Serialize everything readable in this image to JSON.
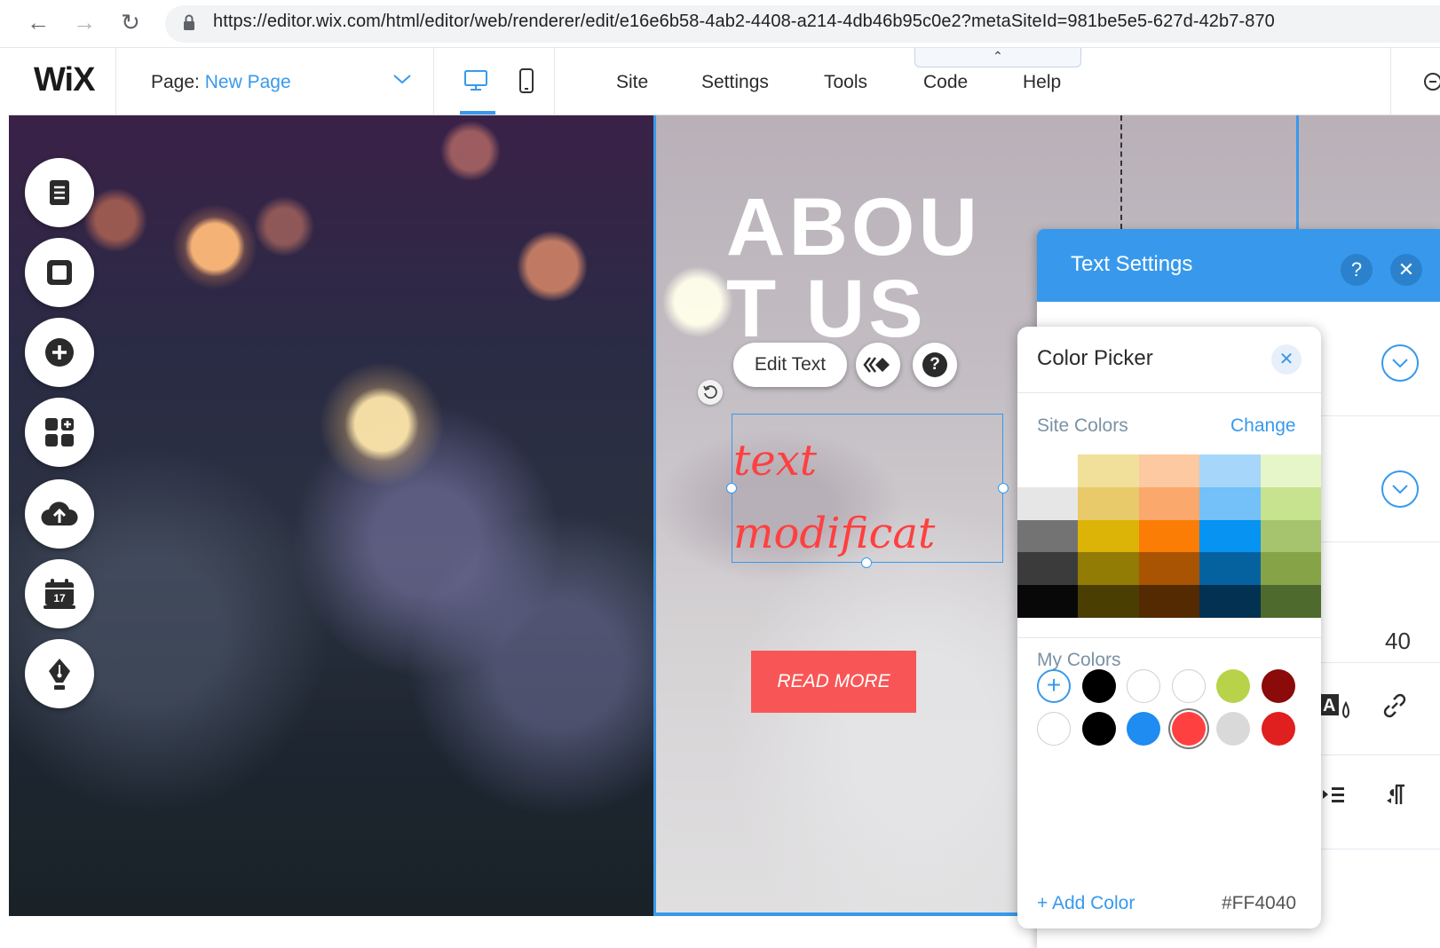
{
  "browser": {
    "url": "https://editor.wix.com/html/editor/web/renderer/edit/e16e6b58-4ab2-4408-a214-4db46b95c0e2?metaSiteId=981be5e5-627d-42b7-870"
  },
  "wix_bar": {
    "logo": "WiX",
    "page_prefix": "Page:",
    "page_name": "New Page",
    "menu": [
      "Site",
      "Settings",
      "Tools",
      "Code",
      "Help"
    ],
    "code_tab_glyph": "⌃"
  },
  "canvas": {
    "about_title_line1": "ABOU",
    "about_title_line2": "T US",
    "edit_text_label": "Edit Text",
    "help_glyph": "?",
    "text_content_line1": "text",
    "text_content_line2": "modificat",
    "read_more_label": "READ MORE"
  },
  "left_tools": [
    "pages-icon",
    "background-icon",
    "add-icon",
    "app-market-icon",
    "upload-icon",
    "calendar-icon",
    "blog-pen-icon"
  ],
  "text_settings": {
    "title": "Text Settings",
    "help_glyph": "?",
    "close_glyph": "✕",
    "font_size_value": "40"
  },
  "color_picker": {
    "title": "Color Picker",
    "close_glyph": "✕",
    "site_colors_label": "Site Colors",
    "change_label": "Change",
    "site_colors": [
      [
        "#ffffff",
        "#f0e09a",
        "#fcc9a0",
        "#a6d6fa",
        "#e6f6c9"
      ],
      [
        "#e6e6e6",
        "#e8ca6a",
        "#fba86c",
        "#74c0f8",
        "#c7e38f"
      ],
      [
        "#737373",
        "#dcb407",
        "#fb7d05",
        "#0693f1",
        "#a6c46e"
      ],
      [
        "#3b3b3b",
        "#937c06",
        "#a85403",
        "#05629f",
        "#86a347"
      ],
      [
        "#080808",
        "#4a3e03",
        "#542a02",
        "#033151",
        "#4f6a2d"
      ]
    ],
    "my_colors_label": "My Colors",
    "my_colors_row1": [
      "add",
      "#000000",
      "#ffffff",
      "#ffffff",
      "#b8d24a",
      "#8b0a0a"
    ],
    "my_colors_row2": [
      "#ffffff",
      "#000000",
      "#1e8cf0",
      "#ff4040",
      "#d9d9d9",
      "#e01f1f"
    ],
    "add_color_label": "+ Add Color",
    "hex_value": "#FF4040"
  }
}
